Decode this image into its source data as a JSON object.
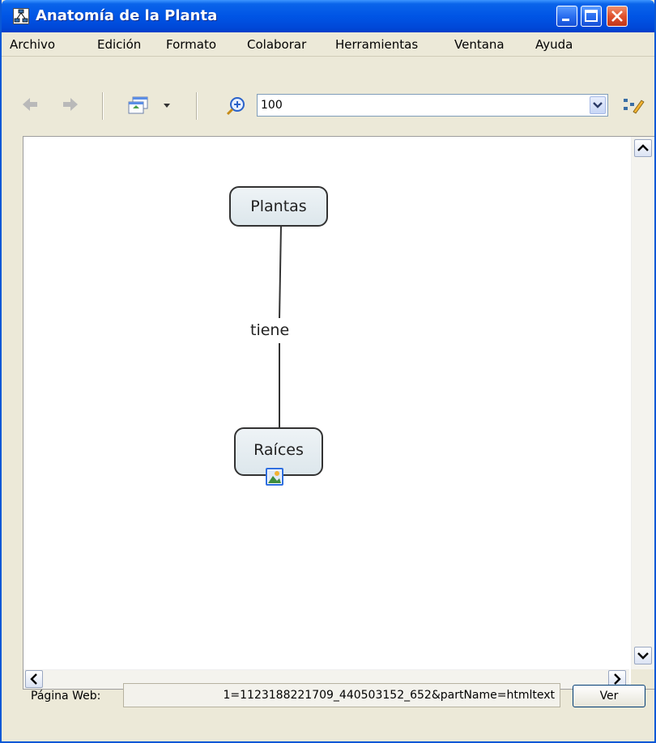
{
  "window": {
    "title": "Anatomía de la Planta"
  },
  "menu": {
    "items": [
      "Archivo",
      "Edición",
      "Formato",
      "Colaborar",
      "Herramientas",
      "Ventana",
      "Ayuda"
    ]
  },
  "toolbar": {
    "zoom_value": "100"
  },
  "map": {
    "node_top": "Plantas",
    "link": "tiene",
    "node_bottom": "Raíces"
  },
  "status": {
    "label": "Página Web:",
    "url": "1=1123188221709_440503152_652&partName=htmltext",
    "view_button": "Ver"
  }
}
